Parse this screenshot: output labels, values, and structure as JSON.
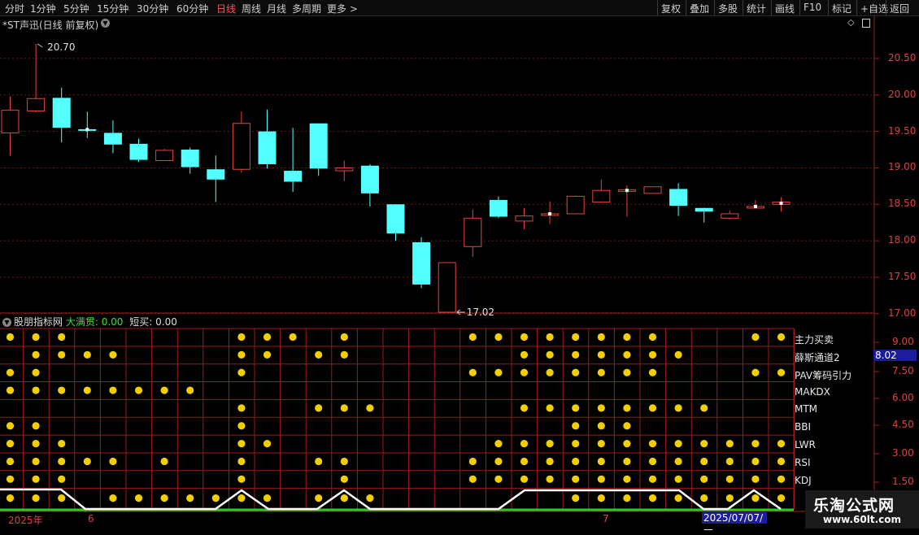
{
  "toolbar": {
    "left": [
      "分时",
      "1分钟",
      "5分钟",
      "15分钟",
      "30分钟",
      "60分钟",
      "日线",
      "周线",
      "月线",
      "多周期",
      "更多 >"
    ],
    "active": "日线",
    "right": [
      "复权",
      "叠加",
      "多股",
      "统计",
      "画线",
      "F10",
      "标记",
      "+自选",
      "返回"
    ]
  },
  "title": "*ST声迅(日线 前复权)",
  "main_chart": {
    "high_label": "20.70",
    "low_label": "17.02",
    "y_ticks": [
      "20.50",
      "20.00",
      "19.50",
      "19.00",
      "18.50",
      "18.00",
      "17.50",
      "17.00"
    ],
    "ylim": [
      16.85,
      20.85
    ],
    "up_color": "#e8443a",
    "down_color": "#54ffff",
    "candles": [
      {
        "o": 19.48,
        "h": 19.98,
        "l": 19.17,
        "c": 19.79
      },
      {
        "o": 19.78,
        "h": 20.7,
        "l": 19.76,
        "c": 19.95
      },
      {
        "o": 19.96,
        "h": 20.1,
        "l": 19.35,
        "c": 19.55
      },
      {
        "o": 19.53,
        "h": 19.77,
        "l": 19.41,
        "c": 19.52
      },
      {
        "o": 19.48,
        "h": 19.65,
        "l": 19.2,
        "c": 19.32
      },
      {
        "o": 19.33,
        "h": 19.4,
        "l": 19.08,
        "c": 19.11
      },
      {
        "o": 19.1,
        "h": 19.26,
        "l": 19.1,
        "c": 19.24
      },
      {
        "o": 19.25,
        "h": 19.28,
        "l": 18.92,
        "c": 19.01
      },
      {
        "o": 18.98,
        "h": 19.17,
        "l": 18.53,
        "c": 18.84
      },
      {
        "o": 18.98,
        "h": 19.77,
        "l": 18.93,
        "c": 19.61
      },
      {
        "o": 19.5,
        "h": 19.8,
        "l": 18.99,
        "c": 19.05
      },
      {
        "o": 18.96,
        "h": 19.55,
        "l": 18.67,
        "c": 18.81
      },
      {
        "o": 19.61,
        "h": 19.61,
        "l": 18.89,
        "c": 18.99
      },
      {
        "o": 18.96,
        "h": 19.1,
        "l": 18.82,
        "c": 19.0
      },
      {
        "o": 19.03,
        "h": 19.05,
        "l": 18.47,
        "c": 18.65
      },
      {
        "o": 18.5,
        "h": 18.5,
        "l": 18.0,
        "c": 18.1
      },
      {
        "o": 17.98,
        "h": 18.05,
        "l": 17.35,
        "c": 17.4
      },
      {
        "o": 17.02,
        "h": 17.7,
        "l": 17.02,
        "c": 17.7
      },
      {
        "o": 17.92,
        "h": 18.43,
        "l": 17.78,
        "c": 18.31
      },
      {
        "o": 18.56,
        "h": 18.61,
        "l": 18.31,
        "c": 18.33
      },
      {
        "o": 18.27,
        "h": 18.45,
        "l": 18.16,
        "c": 18.34
      },
      {
        "o": 18.37,
        "h": 18.54,
        "l": 18.23,
        "c": 18.37
      },
      {
        "o": 18.37,
        "h": 18.62,
        "l": 18.37,
        "c": 18.61
      },
      {
        "o": 18.53,
        "h": 18.84,
        "l": 18.53,
        "c": 18.69
      },
      {
        "o": 18.68,
        "h": 18.76,
        "l": 18.33,
        "c": 18.7
      },
      {
        "o": 18.65,
        "h": 18.74,
        "l": 18.65,
        "c": 18.74
      },
      {
        "o": 18.71,
        "h": 18.79,
        "l": 18.34,
        "c": 18.48
      },
      {
        "o": 18.45,
        "h": 18.45,
        "l": 18.25,
        "c": 18.4
      },
      {
        "o": 18.31,
        "h": 18.41,
        "l": 18.29,
        "c": 18.37
      },
      {
        "o": 18.47,
        "h": 18.56,
        "l": 18.45,
        "c": 18.47
      },
      {
        "o": 18.5,
        "h": 18.6,
        "l": 18.4,
        "c": 18.53
      }
    ]
  },
  "indicator": {
    "name": "股朋指标网",
    "label1": "大满贯:",
    "value1": "0.00",
    "label2": "短买:",
    "value2": "0.00",
    "current_value": "8.02",
    "y_ticks": [
      "9.00",
      "7.50",
      "6.00",
      "4.50",
      "3.00",
      "1.50"
    ],
    "dot_color": "#f2d000",
    "rows": [
      {
        "name": "主力买卖",
        "dots": [
          0,
          1,
          2,
          9,
          10,
          11,
          13,
          18,
          19,
          20,
          21,
          22,
          23,
          24,
          25,
          29,
          30
        ]
      },
      {
        "name": "薛斯通道2",
        "dots": [
          1,
          2,
          3,
          4,
          9,
          10,
          12,
          13,
          20,
          21,
          22,
          23,
          24,
          25,
          26
        ]
      },
      {
        "name": "PAV筹码引力",
        "dots": [
          0,
          1,
          9,
          18,
          19,
          20,
          21,
          22,
          23,
          24,
          25,
          29,
          30
        ]
      },
      {
        "name": "MAKDX",
        "dots": [
          0,
          1,
          2,
          3,
          4,
          5,
          6,
          7
        ]
      },
      {
        "name": "MTM",
        "dots": [
          9,
          12,
          13,
          14,
          20,
          21,
          22,
          23,
          24,
          25,
          26,
          27
        ]
      },
      {
        "name": "BBI",
        "dots": [
          0,
          1,
          9,
          22,
          23,
          24
        ]
      },
      {
        "name": "LWR",
        "dots": [
          0,
          1,
          2,
          9,
          10,
          19,
          20,
          21,
          22,
          23,
          24,
          25,
          26,
          27,
          28,
          29,
          30
        ]
      },
      {
        "name": "RSI",
        "dots": [
          0,
          1,
          2,
          3,
          4,
          6,
          9,
          12,
          13,
          18,
          19,
          20,
          21,
          22,
          23,
          24,
          25,
          26,
          27,
          28,
          29,
          30
        ]
      },
      {
        "name": "KDJ",
        "dots": [
          0,
          1,
          2,
          9,
          13,
          18,
          19,
          20,
          21,
          22,
          23,
          24,
          25,
          26,
          27,
          28,
          29,
          30
        ]
      }
    ],
    "bottom_dots": [
      0,
      1,
      2,
      4,
      5,
      6,
      7,
      8,
      9,
      10,
      12,
      13,
      14,
      22,
      23,
      24,
      25,
      26,
      27,
      28,
      29,
      30
    ]
  },
  "date_axis": {
    "year_label": "2025年",
    "m1": "6",
    "m2": "7",
    "cursor_date": "2025/07/07/—"
  },
  "watermark": {
    "title": "乐淘公式网",
    "url": "www.60lt.com"
  }
}
